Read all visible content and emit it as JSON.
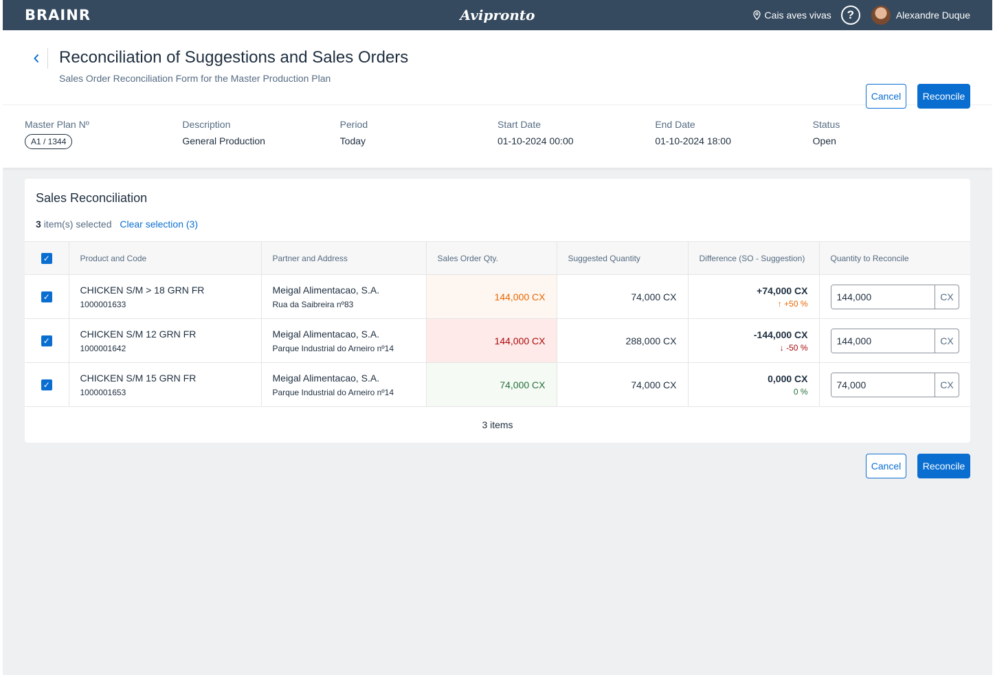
{
  "shell": {
    "brand": "BRAINR",
    "center_logo": "Avipronto",
    "location": "Cais aves vivas",
    "help_glyph": "?",
    "user_name": "Alexandre Duque"
  },
  "header": {
    "title": "Reconciliation of Suggestions and Sales Orders",
    "subtitle": "Sales Order Reconciliation Form for the Master Production Plan",
    "cancel_label": "Cancel",
    "reconcile_label": "Reconcile"
  },
  "info": {
    "master_plan_label": "Master Plan Nº",
    "master_plan_value": "A1 / 1344",
    "description_label": "Description",
    "description_value": "General Production",
    "period_label": "Period",
    "period_value": "Today",
    "start_label": "Start Date",
    "start_value": "01-10-2024 00:00",
    "end_label": "End Date",
    "end_value": "01-10-2024 18:00",
    "status_label": "Status",
    "status_value": "Open"
  },
  "card": {
    "title": "Sales Reconciliation",
    "selected_count": "3",
    "selected_text": "item(s) selected",
    "clear_label": "Clear selection (3)",
    "columns": {
      "product": "Product and Code",
      "partner": "Partner and Address",
      "so_qty": "Sales Order Qty.",
      "suggested": "Suggested Quantity",
      "difference": "Difference (SO - Suggestion)",
      "to_reconcile": "Quantity to Reconcile"
    },
    "rows": [
      {
        "product": "CHICKEN S/M > 18 GRN FR",
        "code": "1000001633",
        "partner": "Meigal Alimentacao, S.A.",
        "address": "Rua da Saibreira nº83",
        "so_qty": "144,000 CX",
        "suggested": "74,000 CX",
        "difference": "+74,000 CX",
        "pct": "+50 %",
        "arrow": "↑",
        "qty_value": "144,000",
        "unit": "CX"
      },
      {
        "product": "CHICKEN S/M 12 GRN FR",
        "code": "1000001642",
        "partner": "Meigal Alimentacao, S.A.",
        "address": "Parque Industrial do Arneiro nº14",
        "so_qty": "144,000 CX",
        "suggested": "288,000 CX",
        "difference": "-144,000 CX",
        "pct": "-50 %",
        "arrow": "↓",
        "qty_value": "144,000",
        "unit": "CX"
      },
      {
        "product": "CHICKEN S/M 15 GRN FR",
        "code": "1000001653",
        "partner": "Meigal Alimentacao, S.A.",
        "address": "Parque Industrial do Arneiro nº14",
        "so_qty": "74,000 CX",
        "suggested": "74,000 CX",
        "difference": "0,000 CX",
        "pct": "0 %",
        "arrow": "",
        "qty_value": "74,000",
        "unit": "CX"
      }
    ],
    "footer": "3 items"
  },
  "colors": {
    "accent": "#0a6ed1",
    "shell_bg": "#354a5f",
    "warning_text": "#e76500",
    "warning_bg": "#fef7f1",
    "negative_text": "#aa0808",
    "negative_bg": "#ffeaea",
    "positive_text": "#256f3a",
    "positive_bg": "#f5faf5"
  }
}
